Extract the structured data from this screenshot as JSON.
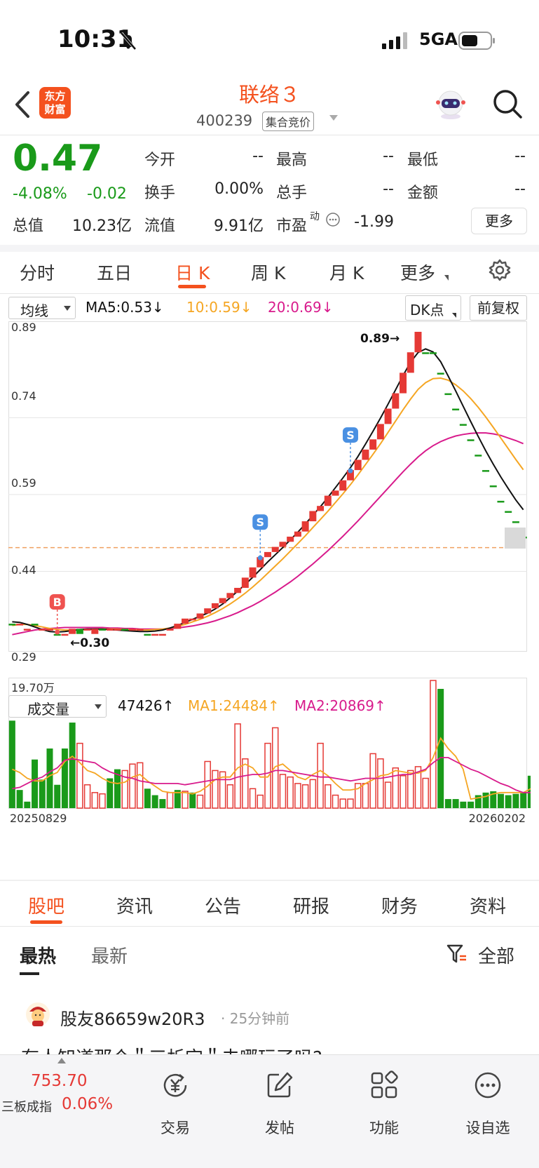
{
  "status_bar": {
    "time": "10:31",
    "network": "5GA"
  },
  "header": {
    "logo_line1": "东方",
    "logo_line2": "财富",
    "stock_name": "联络３",
    "stock_code": "400239",
    "trade_status": "集合竞价"
  },
  "quote": {
    "price": "0.47",
    "change_pct": "-4.08%",
    "change_abs": "-0.02",
    "fields": {
      "open_label": "今开",
      "open_value": "--",
      "high_label": "最高",
      "high_value": "--",
      "low_label": "最低",
      "low_value": "--",
      "turnover_label": "换手",
      "turnover_value": "0.00%",
      "volume_label": "总手",
      "volume_value": "--",
      "amount_label": "金额",
      "amount_value": "--",
      "mktcap_label": "总值",
      "mktcap_value": "10.23亿",
      "float_label": "流值",
      "float_value": "9.91亿",
      "pe_label": "市盈",
      "pe_sup": "动",
      "pe_value": "-1.99"
    },
    "more_label": "更多"
  },
  "period_tabs": [
    "分时",
    "五日",
    "日 K",
    "周 K",
    "月 K",
    "更多"
  ],
  "ma_row": {
    "selector": "均线",
    "ma5": "MA5:0.53↓",
    "ma10": "10:0.59↓",
    "ma20": "20:0.69↓",
    "dk": "DK点",
    "adjust": "前复权"
  },
  "colors": {
    "up": "#e53935",
    "down": "#1a9a1a",
    "accent": "#f4511e",
    "ma5": "#111111",
    "ma10": "#f5a623",
    "ma20": "#d81b8c",
    "signal_s": "#4a90e2",
    "signal_b": "#ef5350"
  },
  "chart_labels": {
    "price_ticks": [
      "0.89",
      "0.74",
      "0.59",
      "0.44",
      "0.29"
    ],
    "high_mark": "0.89→",
    "low_mark": "←0.30",
    "sell_signal": "S",
    "buy_signal": "B",
    "vol_top": "19.70万",
    "date_start": "20250829",
    "date_end": "20260202"
  },
  "vol_row": {
    "selector": "成交量",
    "vol": "47426↑",
    "ma1": "MA1:24484↑",
    "ma2": "MA2:20869↑"
  },
  "chart_data": {
    "type": "candlestick",
    "price_ylim": [
      0.29,
      0.89
    ],
    "x_start": "20250829",
    "x_end": "20260202",
    "candles": [
      [
        0.32,
        0.32
      ],
      [
        0.32,
        0.32
      ],
      [
        0.31,
        0.31
      ],
      [
        0.32,
        0.32
      ],
      [
        0.31,
        0.31
      ],
      [
        0.31,
        0.31
      ],
      [
        0.3,
        0.3
      ],
      [
        0.3,
        0.3
      ],
      [
        0.3,
        0.31
      ],
      [
        0.3,
        0.31
      ],
      [
        0.31,
        0.31
      ],
      [
        0.3,
        0.31
      ],
      [
        0.31,
        0.31
      ],
      [
        0.31,
        0.31
      ],
      [
        0.31,
        0.31
      ],
      [
        0.31,
        0.31
      ],
      [
        0.31,
        0.31
      ],
      [
        0.31,
        0.31
      ],
      [
        0.3,
        0.3
      ],
      [
        0.3,
        0.3
      ],
      [
        0.3,
        0.3
      ],
      [
        0.31,
        0.31
      ],
      [
        0.31,
        0.32
      ],
      [
        0.32,
        0.33
      ],
      [
        0.33,
        0.33
      ],
      [
        0.33,
        0.34
      ],
      [
        0.34,
        0.35
      ],
      [
        0.35,
        0.36
      ],
      [
        0.36,
        0.37
      ],
      [
        0.37,
        0.38
      ],
      [
        0.38,
        0.39
      ],
      [
        0.39,
        0.41
      ],
      [
        0.41,
        0.43
      ],
      [
        0.43,
        0.45
      ],
      [
        0.45,
        0.46
      ],
      [
        0.46,
        0.47
      ],
      [
        0.47,
        0.48
      ],
      [
        0.48,
        0.49
      ],
      [
        0.49,
        0.5
      ],
      [
        0.5,
        0.52
      ],
      [
        0.52,
        0.54
      ],
      [
        0.54,
        0.55
      ],
      [
        0.55,
        0.57
      ],
      [
        0.57,
        0.58
      ],
      [
        0.58,
        0.6
      ],
      [
        0.6,
        0.62
      ],
      [
        0.62,
        0.64
      ],
      [
        0.64,
        0.66
      ],
      [
        0.66,
        0.68
      ],
      [
        0.68,
        0.71
      ],
      [
        0.71,
        0.74
      ],
      [
        0.74,
        0.77
      ],
      [
        0.77,
        0.81
      ],
      [
        0.81,
        0.85
      ],
      [
        0.85,
        0.89
      ],
      [
        0.85,
        0.85
      ],
      [
        0.85,
        0.85
      ],
      [
        0.81,
        0.81
      ],
      [
        0.77,
        0.77
      ],
      [
        0.74,
        0.74
      ],
      [
        0.71,
        0.71
      ],
      [
        0.68,
        0.68
      ],
      [
        0.65,
        0.65
      ],
      [
        0.62,
        0.62
      ],
      [
        0.59,
        0.59
      ],
      [
        0.56,
        0.56
      ],
      [
        0.54,
        0.54
      ],
      [
        0.52,
        0.52
      ],
      [
        0.49,
        0.49
      ]
    ],
    "current_price": 0.47,
    "ma5": [
      0.325,
      0.324,
      0.32,
      0.315,
      0.31,
      0.306,
      0.305,
      0.306,
      0.308,
      0.31,
      0.311,
      0.311,
      0.311,
      0.31,
      0.309,
      0.308,
      0.307,
      0.306,
      0.306,
      0.307,
      0.309,
      0.313,
      0.318,
      0.324,
      0.33,
      0.336,
      0.342,
      0.35,
      0.36,
      0.372,
      0.385,
      0.398,
      0.412,
      0.427,
      0.442,
      0.456,
      0.47,
      0.485,
      0.5,
      0.516,
      0.533,
      0.55,
      0.568,
      0.587,
      0.606,
      0.626,
      0.648,
      0.672,
      0.697,
      0.723,
      0.75,
      0.778,
      0.806,
      0.832,
      0.851,
      0.858,
      0.852,
      0.833,
      0.805,
      0.776,
      0.746,
      0.716,
      0.687,
      0.659,
      0.633,
      0.608,
      0.585,
      0.563,
      0.544
    ],
    "ma10": [
      0.318,
      0.32,
      0.32,
      0.318,
      0.315,
      0.312,
      0.31,
      0.309,
      0.309,
      0.309,
      0.31,
      0.311,
      0.311,
      0.311,
      0.311,
      0.31,
      0.31,
      0.309,
      0.309,
      0.31,
      0.311,
      0.313,
      0.316,
      0.32,
      0.325,
      0.33,
      0.336,
      0.343,
      0.351,
      0.36,
      0.37,
      0.381,
      0.393,
      0.406,
      0.42,
      0.434,
      0.448,
      0.463,
      0.478,
      0.493,
      0.509,
      0.525,
      0.541,
      0.558,
      0.575,
      0.593,
      0.612,
      0.632,
      0.652,
      0.673,
      0.695,
      0.717,
      0.739,
      0.76,
      0.779,
      0.792,
      0.8,
      0.801,
      0.797,
      0.788,
      0.776,
      0.761,
      0.744,
      0.725,
      0.705,
      0.684,
      0.663,
      0.642,
      0.622
    ],
    "ma20": [
      0.3,
      0.303,
      0.306,
      0.309,
      0.311,
      0.312,
      0.313,
      0.314,
      0.314,
      0.314,
      0.314,
      0.314,
      0.314,
      0.313,
      0.313,
      0.312,
      0.312,
      0.311,
      0.311,
      0.311,
      0.311,
      0.312,
      0.313,
      0.315,
      0.317,
      0.32,
      0.323,
      0.327,
      0.332,
      0.337,
      0.343,
      0.35,
      0.357,
      0.365,
      0.374,
      0.383,
      0.393,
      0.403,
      0.414,
      0.426,
      0.438,
      0.451,
      0.464,
      0.478,
      0.492,
      0.507,
      0.522,
      0.538,
      0.554,
      0.57,
      0.586,
      0.602,
      0.618,
      0.633,
      0.647,
      0.659,
      0.669,
      0.677,
      0.683,
      0.688,
      0.691,
      0.693,
      0.694,
      0.694,
      0.692,
      0.689,
      0.684,
      0.679,
      0.673
    ],
    "signals": [
      {
        "type": "B",
        "index": 6,
        "price": 0.305
      },
      {
        "type": "S",
        "index": 33,
        "price": 0.45
      },
      {
        "type": "S",
        "index": 45,
        "price": 0.62
      }
    ],
    "volume_ylim": [
      0,
      197000
    ],
    "volume": [
      {
        "v": 135000,
        "up": false
      },
      {
        "v": 28000,
        "up": false
      },
      {
        "v": 10000,
        "up": false
      },
      {
        "v": 75000,
        "up": false
      },
      {
        "v": 44000,
        "up": false
      },
      {
        "v": 92000,
        "up": false
      },
      {
        "v": 36000,
        "up": false
      },
      {
        "v": 92000,
        "up": false
      },
      {
        "v": 132000,
        "up": false
      },
      {
        "v": 100000,
        "up": true
      },
      {
        "v": 36000,
        "up": true
      },
      {
        "v": 24000,
        "up": true
      },
      {
        "v": 22000,
        "up": true
      },
      {
        "v": 46000,
        "up": false
      },
      {
        "v": 60000,
        "up": false
      },
      {
        "v": 58000,
        "up": true
      },
      {
        "v": 68000,
        "up": true
      },
      {
        "v": 70000,
        "up": true
      },
      {
        "v": 30000,
        "up": false
      },
      {
        "v": 20000,
        "up": false
      },
      {
        "v": 14000,
        "up": false
      },
      {
        "v": 24000,
        "up": true
      },
      {
        "v": 28000,
        "up": false
      },
      {
        "v": 26000,
        "up": true
      },
      {
        "v": 24000,
        "up": false
      },
      {
        "v": 20000,
        "up": true
      },
      {
        "v": 72000,
        "up": true
      },
      {
        "v": 58000,
        "up": true
      },
      {
        "v": 56000,
        "up": true
      },
      {
        "v": 36000,
        "up": true
      },
      {
        "v": 130000,
        "up": true
      },
      {
        "v": 76000,
        "up": true
      },
      {
        "v": 30000,
        "up": true
      },
      {
        "v": 20000,
        "up": true
      },
      {
        "v": 100000,
        "up": true
      },
      {
        "v": 124000,
        "up": true
      },
      {
        "v": 52000,
        "up": true
      },
      {
        "v": 48000,
        "up": true
      },
      {
        "v": 38000,
        "up": true
      },
      {
        "v": 36000,
        "up": true
      },
      {
        "v": 44000,
        "up": true
      },
      {
        "v": 100000,
        "up": true
      },
      {
        "v": 36000,
        "up": true
      },
      {
        "v": 20000,
        "up": true
      },
      {
        "v": 14000,
        "up": true
      },
      {
        "v": 14000,
        "up": true
      },
      {
        "v": 38000,
        "up": true
      },
      {
        "v": 38000,
        "up": true
      },
      {
        "v": 84000,
        "up": true
      },
      {
        "v": 76000,
        "up": true
      },
      {
        "v": 40000,
        "up": true
      },
      {
        "v": 62000,
        "up": true
      },
      {
        "v": 50000,
        "up": true
      },
      {
        "v": 58000,
        "up": true
      },
      {
        "v": 64000,
        "up": true
      },
      {
        "v": 46000,
        "up": true
      },
      {
        "v": 197000,
        "up": true
      },
      {
        "v": 184000,
        "up": false
      },
      {
        "v": 14000,
        "up": false
      },
      {
        "v": 14000,
        "up": false
      },
      {
        "v": 10000,
        "up": false
      },
      {
        "v": 10000,
        "up": false
      },
      {
        "v": 20000,
        "up": false
      },
      {
        "v": 24000,
        "up": false
      },
      {
        "v": 26000,
        "up": false
      },
      {
        "v": 22000,
        "up": false
      },
      {
        "v": 20000,
        "up": false
      },
      {
        "v": 22000,
        "up": false
      },
      {
        "v": 24000,
        "up": false
      },
      {
        "v": 50000,
        "up": false
      }
    ],
    "vol_ma1": [
      60000,
      55000,
      46000,
      42000,
      42000,
      50000,
      55000,
      72000,
      80000,
      70000,
      58000,
      54000,
      46000,
      40000,
      38000,
      40000,
      48000,
      52000,
      42000,
      34000,
      26000,
      24000,
      24000,
      24000,
      22000,
      26000,
      34000,
      44000,
      48000,
      48000,
      62000,
      68000,
      62000,
      48000,
      48000,
      64000,
      68000,
      58000,
      48000,
      44000,
      52000,
      58000,
      50000,
      38000,
      28000,
      28000,
      30000,
      38000,
      44000,
      50000,
      52000,
      58000,
      56000,
      54000,
      54000,
      58000,
      78000,
      108000,
      92000,
      80000,
      60000,
      14000,
      16000,
      18000,
      22000,
      24000,
      24000,
      24000,
      24000,
      30000
    ],
    "vol_ma2": [
      30000,
      32000,
      38000,
      44000,
      48000,
      56000,
      62000,
      74000,
      76000,
      74000,
      72000,
      70000,
      62000,
      56000,
      52000,
      48000,
      46000,
      42000,
      40000,
      38000,
      38000,
      38000,
      38000,
      36000,
      38000,
      40000,
      42000,
      44000,
      44000,
      44000,
      48000,
      50000,
      52000,
      52000,
      54000,
      58000,
      58000,
      56000,
      54000,
      52000,
      50000,
      48000,
      48000,
      46000,
      44000,
      42000,
      44000,
      46000,
      46000,
      46000,
      48000,
      50000,
      52000,
      52000,
      56000,
      60000,
      70000,
      78000,
      78000,
      72000,
      66000,
      60000,
      56000,
      50000,
      44000,
      38000,
      34000,
      28000,
      24000,
      24000
    ]
  },
  "news_tabs": [
    "股吧",
    "资讯",
    "公告",
    "研报",
    "财务",
    "资料"
  ],
  "sub_tabs": [
    "最热",
    "最新"
  ],
  "filter_label": "全部",
  "post": {
    "user": "股友86659w20R3",
    "time": "· 25分钟前",
    "title": "有人知道那个＂三析宝＂去哪玩了吗?"
  },
  "bottom_nav": {
    "index_value": "753.70",
    "index_name": "三板成指",
    "index_change": "0.06%",
    "items": [
      "交易",
      "发帖",
      "功能",
      "设自选"
    ]
  }
}
